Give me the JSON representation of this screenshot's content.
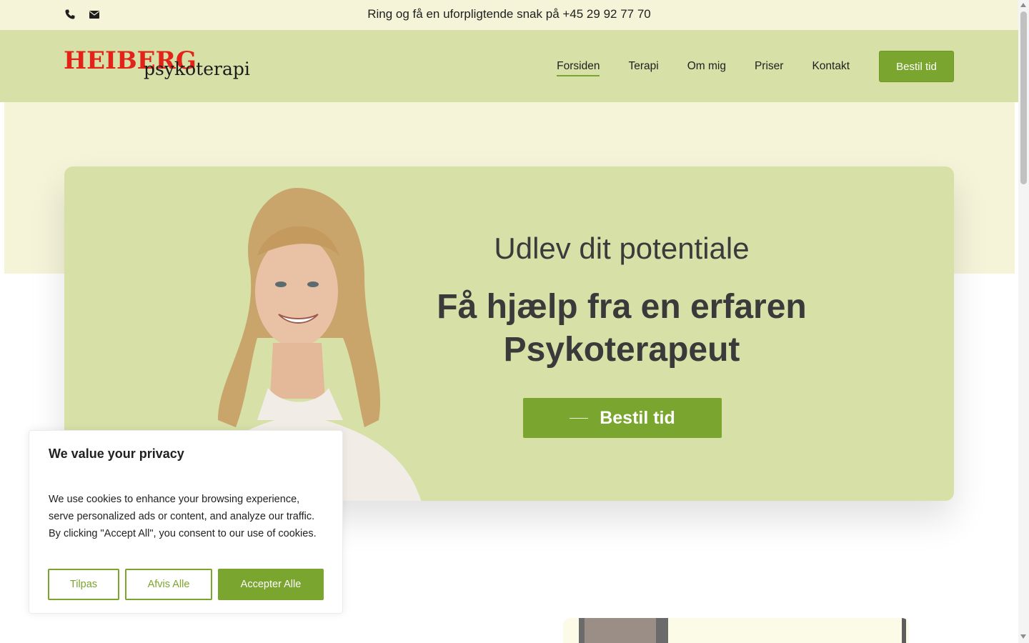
{
  "topbar": {
    "text": "Ring og få en uforpligtende snak på +45 29 92 77 70",
    "icons": [
      "phone-icon",
      "envelope-icon"
    ]
  },
  "header": {
    "logo_main": "HEIBERG",
    "logo_sub": "psykoterapi",
    "nav": [
      {
        "label": "Forsiden",
        "active": true
      },
      {
        "label": "Terapi"
      },
      {
        "label": "Om mig"
      },
      {
        "label": "Priser"
      },
      {
        "label": "Kontakt"
      }
    ],
    "cta_label": "Bestil tid"
  },
  "hero": {
    "kicker": "Udlev dit potentiale",
    "title": "Få hjælp fra en erfaren Psykoterapeut",
    "cta_label": "Bestil tid"
  },
  "cookie": {
    "title": "We value your privacy",
    "body": "We use cookies to enhance your browsing experience, serve personalized ads or content, and analyze our traffic. By clicking \"Accept All\", you consent to our use of cookies.",
    "customize_label": "Tilpas",
    "reject_label": "Afvis Alle",
    "accept_label": "Accepter Alle"
  },
  "colors": {
    "accent": "#7aa52e",
    "header_bg": "#d6e0a7",
    "topbar_bg": "#f5f4d9",
    "logo_red": "#e2231a"
  }
}
